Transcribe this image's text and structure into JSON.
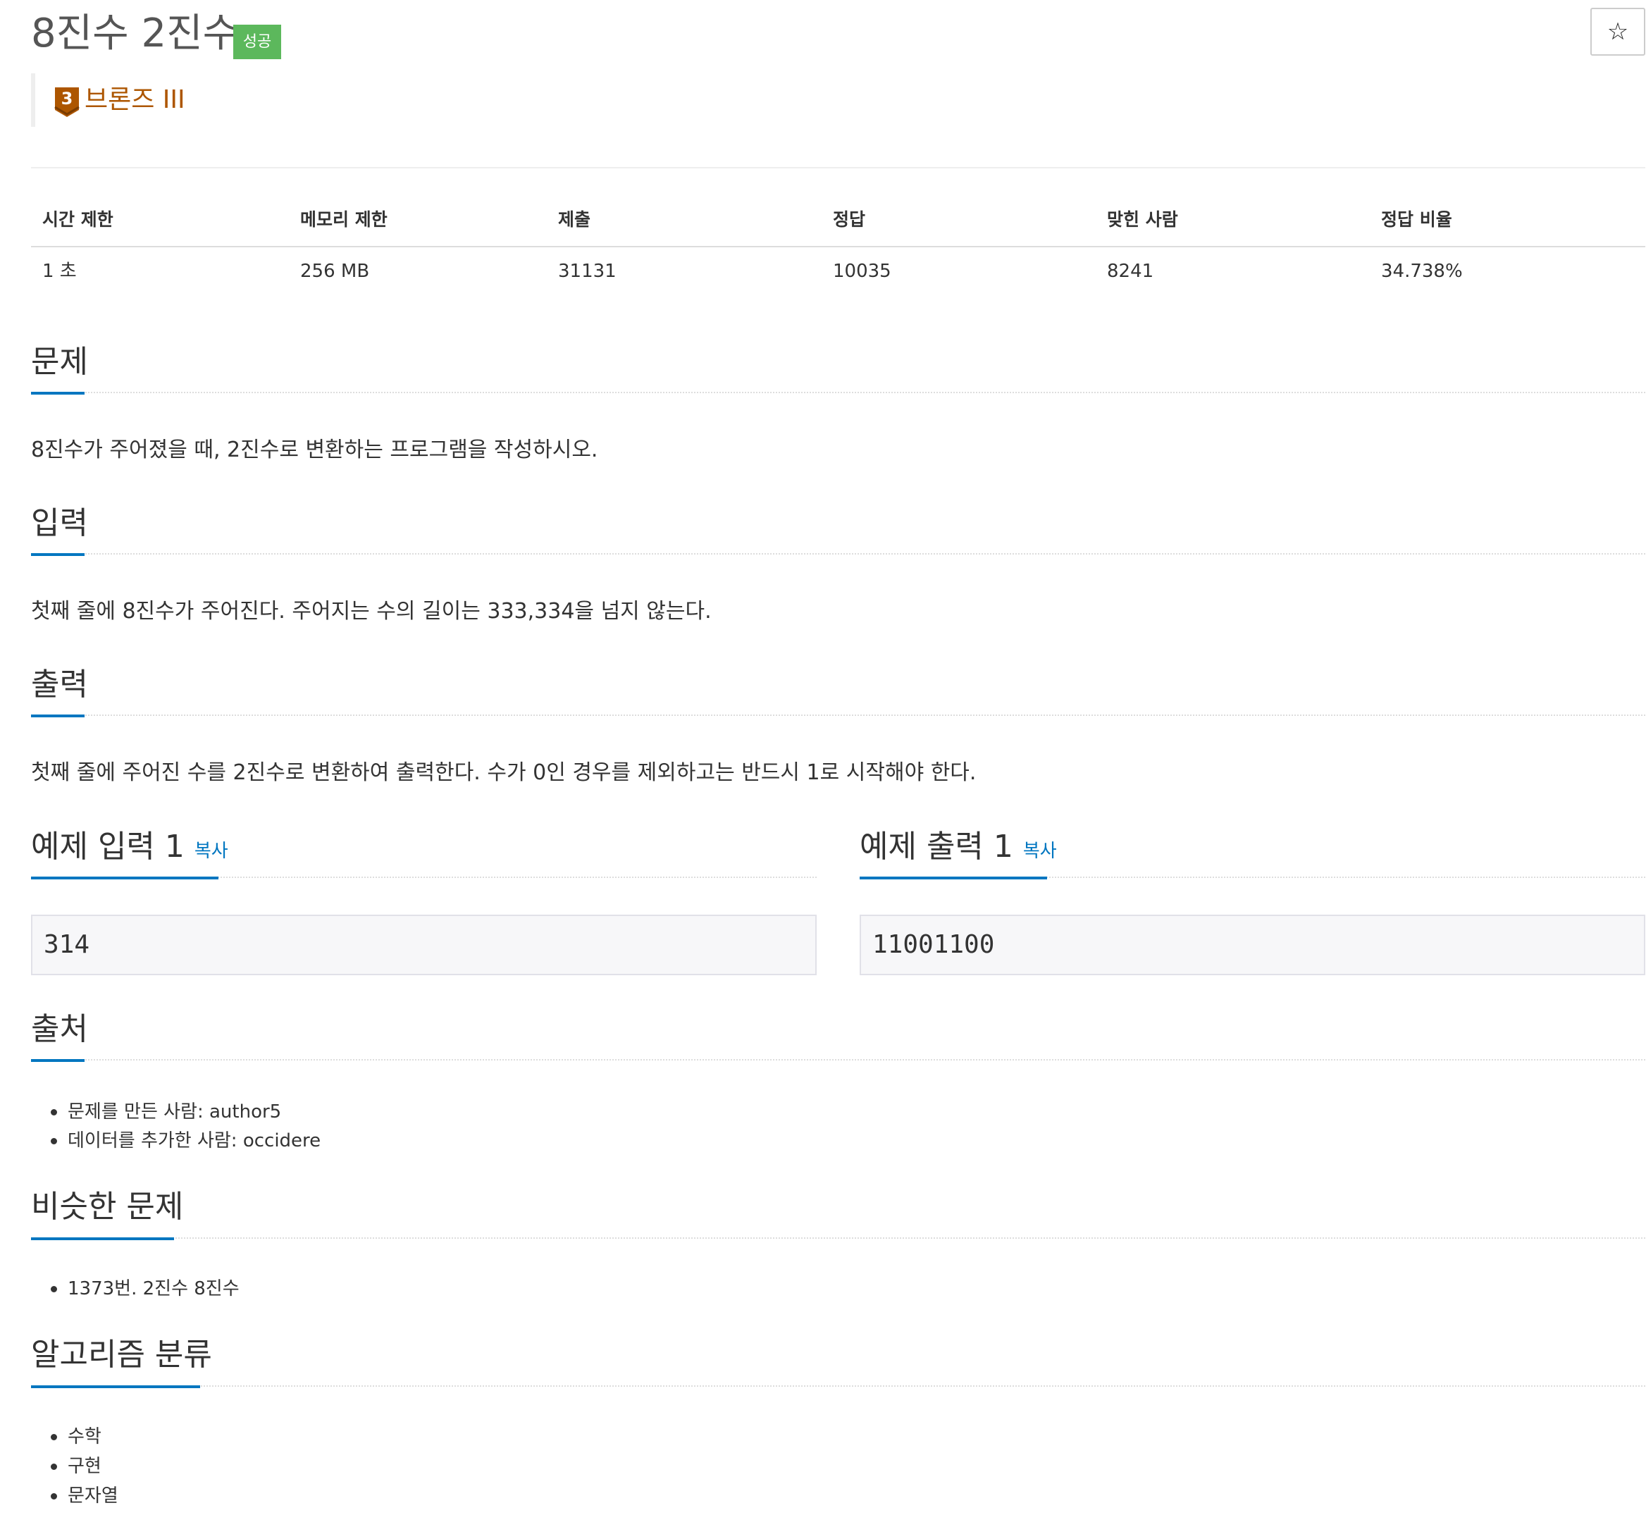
{
  "problem": {
    "title": "8진수 2진수",
    "result_badge": "성공",
    "star_icon": "☆",
    "tier": {
      "label": "브론즈 III",
      "number": "3",
      "color": "#ad5600"
    }
  },
  "info_table": {
    "headers": [
      "시간 제한",
      "메모리 제한",
      "제출",
      "정답",
      "맞힌 사람",
      "정답 비율"
    ],
    "values": [
      "1 초",
      "256 MB",
      "31131",
      "10035",
      "8241",
      "34.738%"
    ]
  },
  "sections": {
    "description": {
      "title": "문제",
      "text": "8진수가 주어졌을 때, 2진수로 변환하는 프로그램을 작성하시오."
    },
    "input": {
      "title": "입력",
      "text": "첫째 줄에 8진수가 주어진다. 주어지는 수의 길이는 333,334을 넘지 않는다."
    },
    "output": {
      "title": "출력",
      "text": "첫째 줄에 주어진 수를 2진수로 변환하여 출력한다. 수가 0인 경우를 제외하고는 반드시 1로 시작해야 한다."
    },
    "sample_input": {
      "title": "예제 입력 1",
      "copy_label": "복사",
      "value": "314"
    },
    "sample_output": {
      "title": "예제 출력 1",
      "copy_label": "복사",
      "value": "11001100"
    },
    "source": {
      "title": "출처",
      "items": [
        "문제를 만든 사람: author5",
        "데이터를 추가한 사람: occidere"
      ]
    },
    "similar": {
      "title": "비슷한 문제",
      "items": [
        "1373번. 2진수 8진수"
      ]
    },
    "algorithm": {
      "title": "알고리즘 분류",
      "items": [
        "수학",
        "구현",
        "문자열"
      ]
    }
  },
  "colors": {
    "accent": "#0076c0",
    "success": "#5cb85c",
    "bronze": "#ad5600"
  }
}
